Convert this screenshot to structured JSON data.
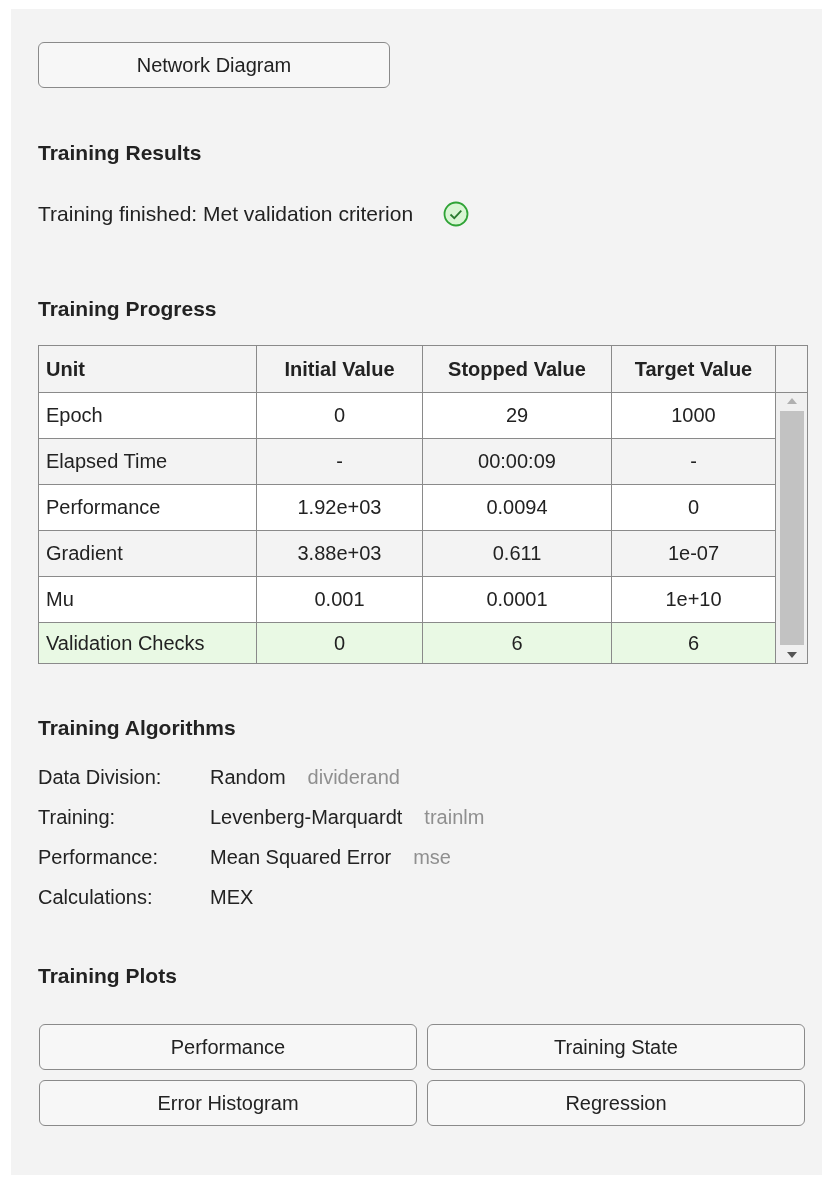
{
  "top_button": "Network Diagram",
  "results": {
    "heading": "Training Results",
    "message": "Training finished: Met validation criterion",
    "kind": "success"
  },
  "progress": {
    "heading": "Training Progress",
    "columns": [
      "Unit",
      "Initial Value",
      "Stopped Value",
      "Target Value"
    ],
    "rows": [
      {
        "cells": [
          "Epoch",
          "0",
          "29",
          "1000"
        ],
        "highlighted": false
      },
      {
        "cells": [
          "Elapsed Time",
          "-",
          "00:00:09",
          "-"
        ],
        "highlighted": false
      },
      {
        "cells": [
          "Performance",
          "1.92e+03",
          "0.0094",
          "0"
        ],
        "highlighted": false
      },
      {
        "cells": [
          "Gradient",
          "3.88e+03",
          "0.611",
          "1e-07"
        ],
        "highlighted": false
      },
      {
        "cells": [
          "Mu",
          "0.001",
          "0.0001",
          "1e+10"
        ],
        "highlighted": false
      },
      {
        "cells": [
          "Validation Checks",
          "0",
          "6",
          "6"
        ],
        "highlighted": true
      }
    ]
  },
  "algorithms": {
    "heading": "Training Algorithms",
    "rows": [
      {
        "label": "Data Division:",
        "value": "Random",
        "function": "dividerand"
      },
      {
        "label": "Training:",
        "value": "Levenberg-Marquardt",
        "function": "trainlm"
      },
      {
        "label": "Performance:",
        "value": "Mean Squared Error",
        "function": "mse"
      },
      {
        "label": "Calculations:",
        "value": "MEX"
      }
    ]
  },
  "plots": {
    "heading": "Training Plots",
    "buttons": [
      "Performance",
      "Training State",
      "Error Histogram",
      "Regression"
    ]
  }
}
